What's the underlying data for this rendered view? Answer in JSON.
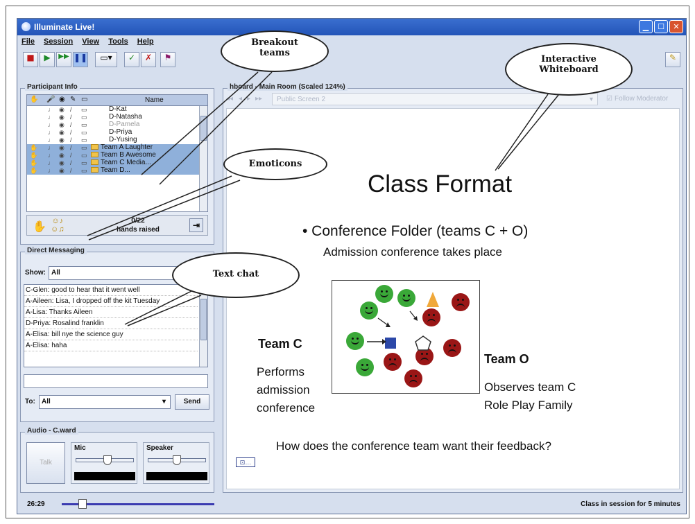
{
  "app": {
    "title": "Illuminate Live!",
    "menus": [
      "File",
      "Session",
      "View",
      "Tools",
      "Help"
    ]
  },
  "participant_info": {
    "title": "Participant Info",
    "column_name": "Name",
    "rows": [
      {
        "name": "D-Kat",
        "type": "person"
      },
      {
        "name": "D-Natasha",
        "type": "person"
      },
      {
        "name": "D-Pamela",
        "type": "person"
      },
      {
        "name": "D-Priya",
        "type": "person"
      },
      {
        "name": "D-Yusing",
        "type": "person"
      },
      {
        "name": "Team A Laughter",
        "type": "team"
      },
      {
        "name": "Team B Awesome",
        "type": "team"
      },
      {
        "name": "Team C Media...",
        "type": "team"
      },
      {
        "name": "Team D...",
        "type": "team"
      }
    ],
    "hands_count": "0/22",
    "hands_label": "hands raised"
  },
  "direct_messaging": {
    "title": "Direct Messaging",
    "show_label": "Show:",
    "show_value": "All",
    "messages": [
      "C-Glen: good to hear that it went well",
      "A-Aileen: Lisa, I dropped off the kit Tuesday",
      "A-Lisa: Thanks Aileen",
      "D-Priya: Rosalind franklin",
      "A-Elisa: bill nye the science guy",
      "A-Elisa: haha"
    ],
    "to_label": "To:",
    "to_value": "All",
    "send_label": "Send"
  },
  "audio": {
    "title": "Audio - C.ward",
    "talk_label": "Talk",
    "mic_label": "Mic",
    "speaker_label": "Speaker",
    "mic_level": 0.55,
    "speaker_level": 0.5
  },
  "whiteboard": {
    "title": "hboard - Main Room (Scaled 124%)",
    "screen_name": "Public Screen 2",
    "follow_label": "Follow Moderator",
    "heading": "Class Format",
    "bullet": "• Conference Folder (teams C + O)",
    "sub": "Admission conference takes place",
    "team_c": "Team C",
    "team_c_desc": [
      "Performs",
      "admission",
      "conference"
    ],
    "team_o": "Team O",
    "team_o_desc": [
      "Observes team C",
      "Role Play Family"
    ],
    "question": "How does the conference team want their feedback?"
  },
  "callouts": {
    "breakout": [
      "Breakout",
      "teams"
    ],
    "whiteboard": [
      "Interactive",
      "Whiteboard"
    ],
    "emoticons": "Emoticons",
    "textchat": "Text chat"
  },
  "status": {
    "time": "26:29",
    "session": "Class in session for 5 minutes"
  }
}
